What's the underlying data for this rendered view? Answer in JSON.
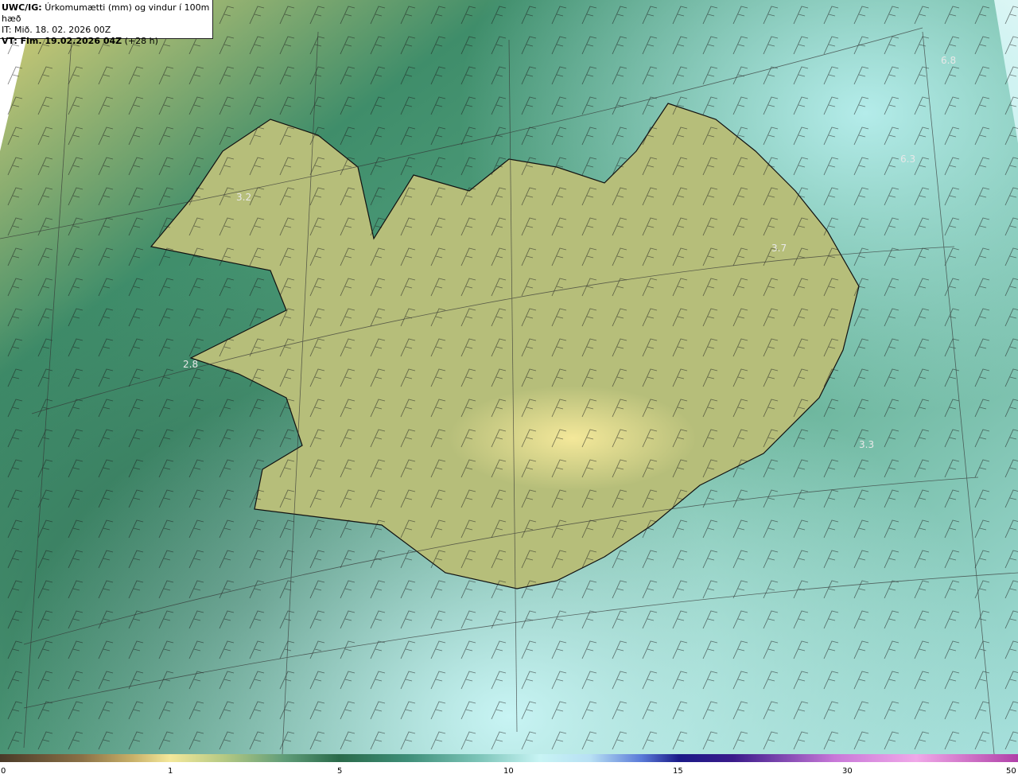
{
  "header": {
    "prefix": "UWC/IG:",
    "title": "Úrkomumætti (mm) og vindur í 100m hæð",
    "it_line": "IT: Mið. 18. 02. 2026 00Z",
    "vt_prefix": "VT: Fim. 19.02.2026 04Z",
    "vt_suffix": "(+28 h)"
  },
  "map_labels": [
    "3.2",
    "2.8",
    "3.7",
    "6.3",
    "3.3",
    "6.8"
  ],
  "scale": {
    "ticks": [
      "0",
      "1",
      "5",
      "10",
      "15",
      "30",
      "50"
    ]
  }
}
